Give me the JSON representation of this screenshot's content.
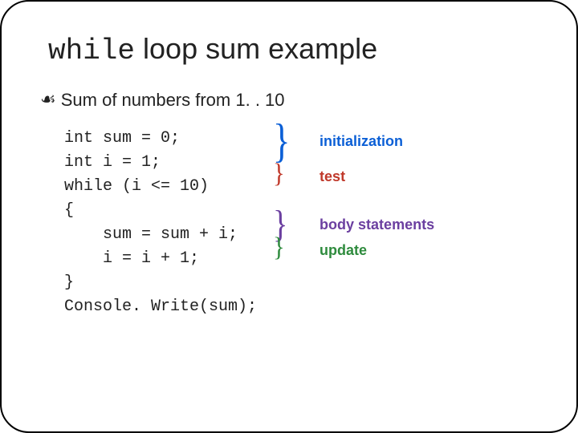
{
  "title": {
    "mono": "while",
    "rest": " loop sum example"
  },
  "bullet": "Sum of numbers from 1. . 10",
  "code": "int sum = 0;\nint i = 1;\nwhile (i <= 10)\n{\n    sum = sum + i;\n    i = i + 1;\n}\nConsole. Write(sum);",
  "annotations": {
    "initialization": "initialization",
    "test": "test",
    "body": "body statements",
    "update": "update"
  },
  "colors": {
    "initialization": "#0b5fd6",
    "test": "#c0392b",
    "body": "#6b3fa0",
    "update": "#2e8b3d"
  }
}
